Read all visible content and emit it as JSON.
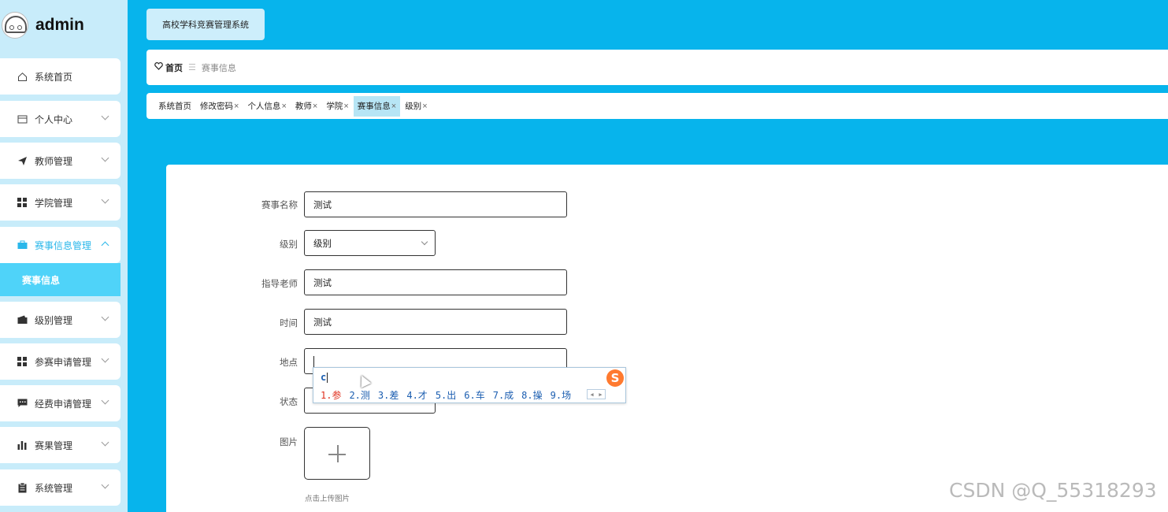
{
  "brand": {
    "title": "admin"
  },
  "sidebar": {
    "items": [
      {
        "label": "系统首页",
        "icon": "home-icon"
      },
      {
        "label": "个人中心",
        "icon": "card-icon"
      },
      {
        "label": "教师管理",
        "icon": "send-icon"
      },
      {
        "label": "学院管理",
        "icon": "grid-icon"
      },
      {
        "label": "赛事信息管理",
        "icon": "briefcase-icon"
      },
      {
        "label": "级别管理",
        "icon": "wallet-icon"
      },
      {
        "label": "参赛申请管理",
        "icon": "grid-icon"
      },
      {
        "label": "经费申请管理",
        "icon": "message-icon"
      },
      {
        "label": "赛果管理",
        "icon": "bar-chart-icon"
      },
      {
        "label": "系统管理",
        "icon": "clipboard-icon"
      }
    ],
    "sub_item": "赛事信息"
  },
  "header": {
    "system_title": "高校学科竞赛管理系统"
  },
  "breadcrumb": {
    "home": "首页",
    "separator": "☰",
    "current": "赛事信息"
  },
  "tabs": [
    {
      "label": "系统首页",
      "closable": false
    },
    {
      "label": "修改密码",
      "closable": true
    },
    {
      "label": "个人信息",
      "closable": true
    },
    {
      "label": "教师",
      "closable": true
    },
    {
      "label": "学院",
      "closable": true
    },
    {
      "label": "赛事信息",
      "closable": true,
      "active": true
    },
    {
      "label": "级别",
      "closable": true
    }
  ],
  "tab_close": "×",
  "form": {
    "name_label": "赛事名称",
    "name_value": "测试",
    "level_label": "级别",
    "level_value": "级别",
    "teacher_label": "指导老师",
    "teacher_value": "测试",
    "time_label": "时间",
    "time_value": "测试",
    "place_label": "地点",
    "place_value": "",
    "status_label": "状态",
    "status_value": "",
    "image_label": "图片",
    "upload_hint": "点击上传图片"
  },
  "ime": {
    "input": "c",
    "candidates": [
      "1.参",
      "2.测",
      "3.差",
      "4.才",
      "5.出",
      "6.车",
      "7.成",
      "8.操",
      "9.场"
    ],
    "logo": "S"
  },
  "watermark": "CSDN @Q_55318293",
  "colors": {
    "background": "#07b4ec",
    "sidebar": "#c8ecfa",
    "active_sub": "#4fd3f9",
    "accent": "#2ab7ea"
  }
}
